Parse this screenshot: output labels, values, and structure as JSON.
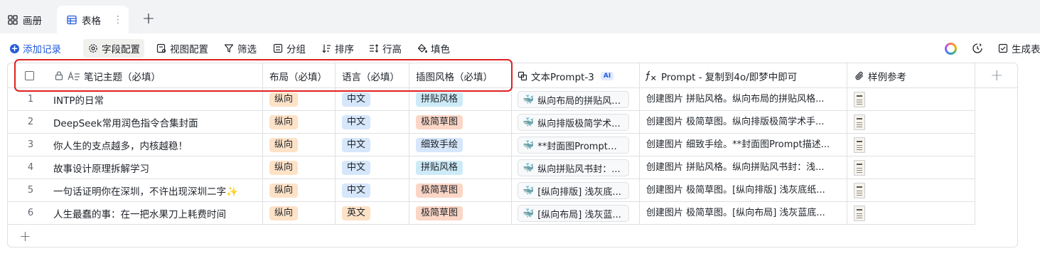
{
  "tabs": [
    {
      "label": "画册",
      "icon": "gallery-grid-icon"
    },
    {
      "label": "表格",
      "icon": "table-icon",
      "active": true
    }
  ],
  "toolbar": {
    "add_record": "添加记录",
    "field_config": "字段配置",
    "view_config": "视图配置",
    "filter": "筛选",
    "group": "分组",
    "sort": "排序",
    "row_height": "行高",
    "fill_color": "填色",
    "generate": "生成表"
  },
  "columns": {
    "title": "笔记主题（必填）",
    "layout": "布局（必填）",
    "language": "语言（必填）",
    "style": "插图风格（必填）",
    "text_prompt": "文本Prompt-3",
    "ai_badge": "AI",
    "formula_prompt": "Prompt - 复制到4o/即梦中即可",
    "sample": "样例参考"
  },
  "rows": [
    {
      "num": "1",
      "title": "INTP的日常",
      "layout": "纵向",
      "language": "中文",
      "style": "拼贴风格",
      "text_prompt": "纵向布局的拼贴风格...",
      "formula": "创建图片 拼贴风格。纵向布局的拼贴风格..."
    },
    {
      "num": "2",
      "title": "DeepSeek常用润色指令合集封面",
      "layout": "纵向",
      "language": "中文",
      "style": "极简草图",
      "text_prompt": "纵向排版极简学术...",
      "formula": "创建图片 极简草图。纵向排版极简学术手..."
    },
    {
      "num": "3",
      "title": "你人生的支点越多，内核越稳！",
      "layout": "纵向",
      "language": "中文",
      "style": "细致手绘",
      "text_prompt": "**封面图Prompt描...",
      "formula": "创建图片 细致手绘。**封面图Prompt描述..."
    },
    {
      "num": "4",
      "title": "故事设计原理拆解学习",
      "layout": "纵向",
      "language": "中文",
      "style": "拼贴风格",
      "text_prompt": "纵向拼贴风书封：...",
      "formula": "创建图片 拼贴风格。纵向拼贴风书封：浅..."
    },
    {
      "num": "5",
      "title": "一句话证明你在深圳，不许出现深圳二字✨",
      "layout": "纵向",
      "language": "中文",
      "style": "极简草图",
      "text_prompt": "[纵向排版] 浅灰底...",
      "formula": "创建图片 极简草图。[纵向排版] 浅灰底纸..."
    },
    {
      "num": "6",
      "title": "人生最蠢的事：在一把水果刀上耗费时间",
      "layout": "纵向",
      "language": "英文",
      "style": "极简草图",
      "text_prompt": "[纵向布局] 浅灰蓝...",
      "formula": "创建图片 极简草图。[纵向布局] 浅灰蓝底..."
    }
  ],
  "tag_colors": {
    "layout": "#fde2c7",
    "language_cn": "#d6e6fb",
    "language_en": "#fde2c7",
    "style_collage": "#cdeaf7",
    "style_sketch": "#fbd6c6",
    "style_detail": "#d6e6fb"
  }
}
